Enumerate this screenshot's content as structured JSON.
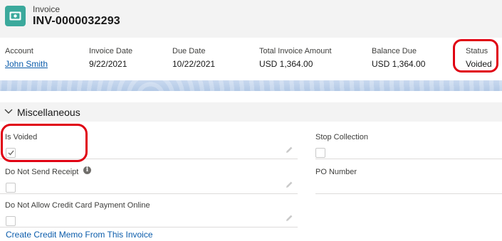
{
  "header": {
    "object_type": "Invoice",
    "record_name": "INV-0000032293",
    "icon": "invoice-cash-icon",
    "icon_color": "#3ba99c"
  },
  "highlights": {
    "account": {
      "label": "Account",
      "value": "John Smith"
    },
    "invoice_date": {
      "label": "Invoice Date",
      "value": "9/22/2021"
    },
    "due_date": {
      "label": "Due Date",
      "value": "10/22/2021"
    },
    "total_amount": {
      "label": "Total Invoice Amount",
      "value": "USD 1,364.00"
    },
    "balance_due": {
      "label": "Balance Due",
      "value": "USD 1,364.00"
    },
    "status": {
      "label": "Status",
      "value": "Voided"
    }
  },
  "section": {
    "title": "Miscellaneous",
    "fields": {
      "is_voided": {
        "label": "Is Voided",
        "checked": true
      },
      "stop_collection": {
        "label": "Stop Collection",
        "checked": false
      },
      "do_not_send_receipt": {
        "label": "Do Not Send Receipt",
        "checked": false
      },
      "po_number": {
        "label": "PO Number",
        "value": ""
      },
      "do_not_allow_cc": {
        "label": "Do Not Allow Credit Card Payment Online",
        "checked": false
      }
    }
  },
  "footer": {
    "link": "Create Credit Memo From This Invoice"
  },
  "colors": {
    "link": "#0b5cab",
    "highlight_annotation": "#e00012",
    "section_bg": "#f3f3f3"
  }
}
